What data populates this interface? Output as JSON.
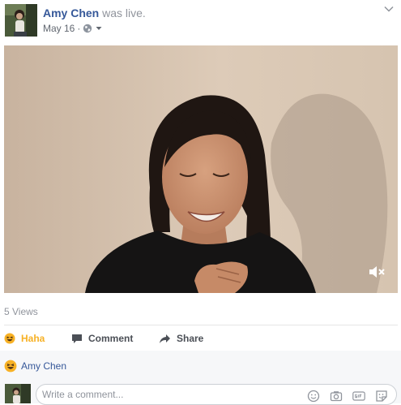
{
  "post": {
    "author": "Amy Chen",
    "action": "was live.",
    "date": "May 16",
    "date_separator": "·",
    "privacy_icon": "globe-icon",
    "menu_icon": "chevron-down-icon"
  },
  "video": {
    "mute_icon": "speaker-muted-icon"
  },
  "stats": {
    "views": "5 Views"
  },
  "actions": {
    "haha_label": "Haha",
    "comment_label": "Comment",
    "share_label": "Share"
  },
  "reactions": {
    "emoji_icon": "haha-emoji-icon",
    "names": "Amy Chen"
  },
  "comment": {
    "placeholder": "Write a comment...",
    "icons": [
      "emoji-icon",
      "camera-icon",
      "gif-icon",
      "sticker-icon"
    ]
  },
  "colors": {
    "link": "#365899",
    "haha": "#f7b125",
    "muted": "#90949c"
  }
}
